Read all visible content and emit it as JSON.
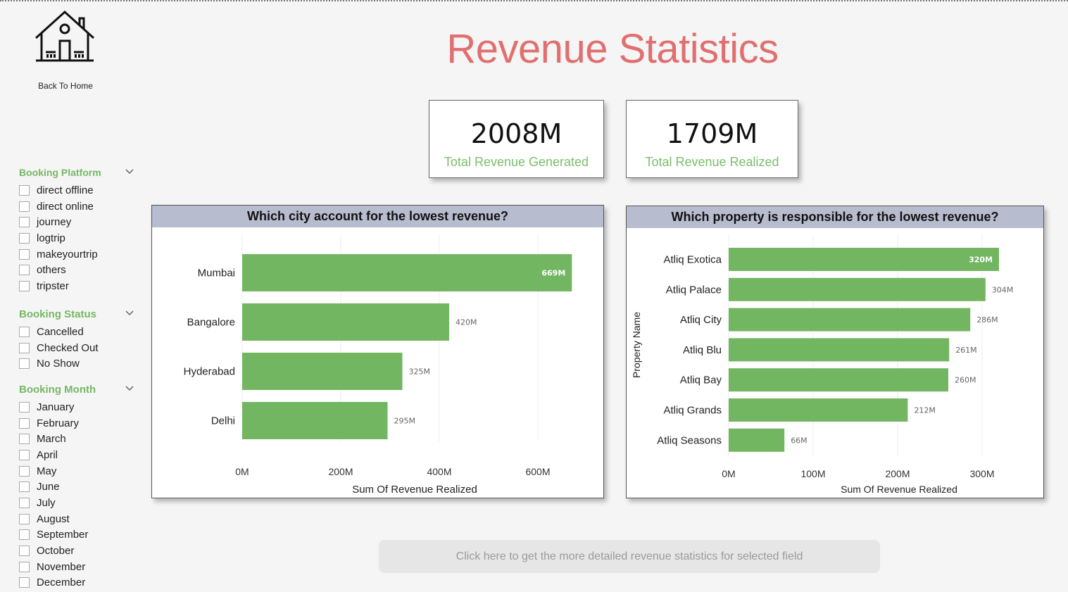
{
  "page_title": "Revenue Statistics",
  "home": {
    "label": "Back To Home",
    "icon": "house-icon"
  },
  "kpis": [
    {
      "value": "2008M",
      "label": "Total Revenue Generated"
    },
    {
      "value": "1709M",
      "label": "Total Revenue Realized"
    }
  ],
  "slicers": {
    "booking_platform": {
      "title": "Booking Platform",
      "items": [
        "direct offline",
        "direct online",
        "journey",
        "logtrip",
        "makeyourtrip",
        "others",
        "tripster"
      ]
    },
    "booking_status": {
      "title": "Booking Status",
      "items": [
        "Cancelled",
        "Checked Out",
        "No Show"
      ]
    },
    "booking_month": {
      "title": "Booking Month",
      "items": [
        "January",
        "February",
        "March",
        "April",
        "May",
        "June",
        "July",
        "August",
        "September",
        "October",
        "November",
        "December"
      ]
    }
  },
  "colors": {
    "bar": "#73b662",
    "title": "#e07070",
    "accent": "#76b865",
    "header": "#b8bccf"
  },
  "chart_data": [
    {
      "type": "bar",
      "orientation": "horizontal",
      "title": "Which city account for the lowest revenue?",
      "categories": [
        "Mumbai",
        "Bangalore",
        "Hyderabad",
        "Delhi"
      ],
      "values": [
        669,
        420,
        325,
        295
      ],
      "data_labels": [
        "669M",
        "420M",
        "325M",
        "295M"
      ],
      "xlabel": "Sum Of Revenue Realized",
      "ylabel": "",
      "xlim": [
        0,
        700
      ],
      "ticks": [
        0,
        200,
        400,
        600
      ],
      "tick_labels": [
        "0M",
        "200M",
        "400M",
        "600M"
      ],
      "grid": true
    },
    {
      "type": "bar",
      "orientation": "horizontal",
      "title": "Which property is responsible for the lowest revenue?",
      "categories": [
        "Atliq Exotica",
        "Atliq Palace",
        "Atliq City",
        "Atliq Blu",
        "Atliq Bay",
        "Atliq Grands",
        "Atliq Seasons"
      ],
      "values": [
        320,
        304,
        286,
        261,
        260,
        212,
        66
      ],
      "data_labels": [
        "320M",
        "304M",
        "286M",
        "261M",
        "260M",
        "212M",
        "66M"
      ],
      "xlabel": "Sum Of Revenue Realized",
      "ylabel": "Property Name",
      "xlim": [
        0,
        370
      ],
      "ticks": [
        0,
        100,
        200,
        300
      ],
      "tick_labels": [
        "0M",
        "100M",
        "200M",
        "300M"
      ],
      "grid": true
    }
  ],
  "detail_button": {
    "label": "Click here to get the more detailed revenue statistics for selected field"
  }
}
